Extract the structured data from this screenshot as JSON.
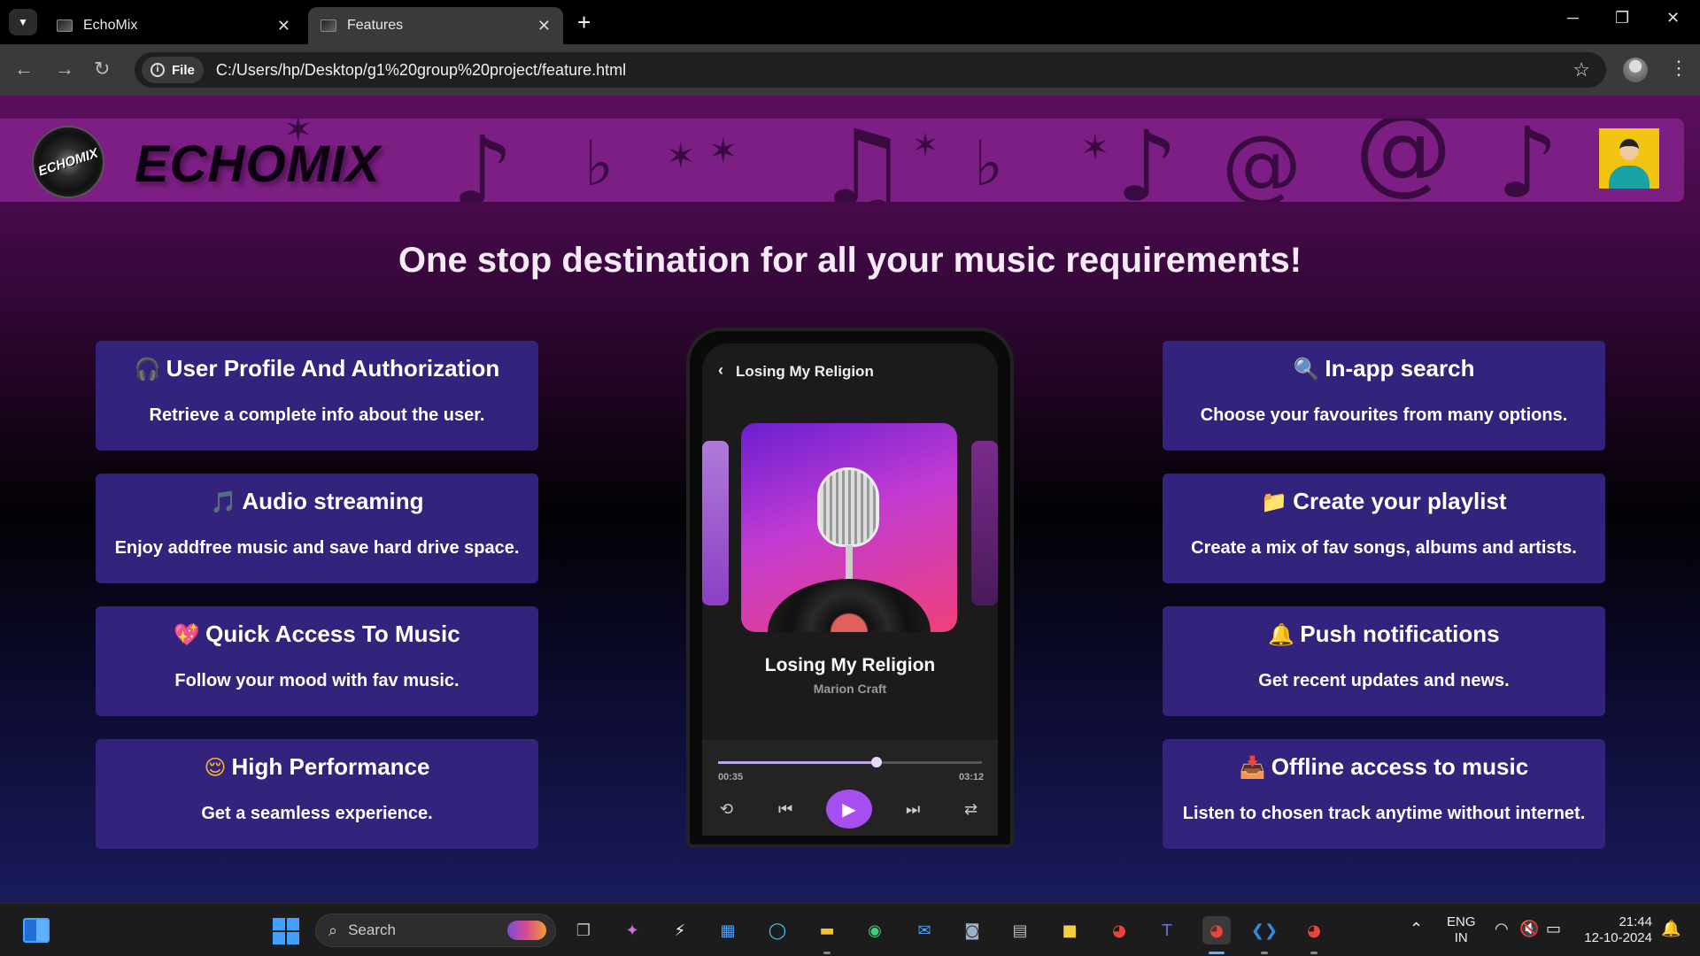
{
  "browser": {
    "tabs": [
      {
        "title": "EchoMix",
        "active": false
      },
      {
        "title": "Features",
        "active": true
      }
    ],
    "new_tab_icon": "+",
    "file_chip": "File",
    "url": "C:/Users/hp/Desktop/g1%20group%20project/feature.html"
  },
  "header": {
    "logo_text": "ECHOMIX",
    "brand": "ECHOMIX"
  },
  "tagline": "One stop destination for all your music requirements!",
  "features_left": [
    {
      "icon": "🎧",
      "icon_name": "headphones-icon",
      "title": "User Profile And Authorization",
      "desc": "Retrieve a complete info about the user."
    },
    {
      "icon": "🎵",
      "icon_name": "music-note-icon",
      "title": "Audio streaming",
      "desc": "Enjoy addfree music and save hard drive space."
    },
    {
      "icon": "💖",
      "icon_name": "heart-icon",
      "title": "Quick Access To Music",
      "desc": "Follow your mood with fav music."
    },
    {
      "icon": "😌",
      "icon_name": "relieved-face-icon",
      "title": "High Performance",
      "desc": "Get a seamless experience."
    }
  ],
  "features_right": [
    {
      "icon": "🔍",
      "icon_name": "search-icon",
      "title": "In-app search",
      "desc": "Choose your favourites from many options."
    },
    {
      "icon": "📁",
      "icon_name": "folder-icon",
      "title": "Create your playlist",
      "desc": "Create a mix of fav songs, albums and artists."
    },
    {
      "icon": "🔔",
      "icon_name": "bell-icon",
      "title": "Push notifications",
      "desc": "Get recent updates and news."
    },
    {
      "icon": "📥",
      "icon_name": "inbox-icon",
      "title": "Offline access to music",
      "desc": "Listen to chosen track anytime without internet."
    }
  ],
  "phone": {
    "header": "Losing My Religion",
    "song": "Losing My Religion",
    "artist": "Marion Craft",
    "elapsed": "00:35",
    "total": "03:12",
    "progress": 0.6
  },
  "taskbar": {
    "search_placeholder": "Search",
    "lang": "ENG",
    "region": "IN",
    "time": "21:44",
    "date": "12-10-2024"
  },
  "colors": {
    "card_bg": "#34237d",
    "header_bg": "#7d1e84",
    "play_button": "#a64ef2"
  }
}
